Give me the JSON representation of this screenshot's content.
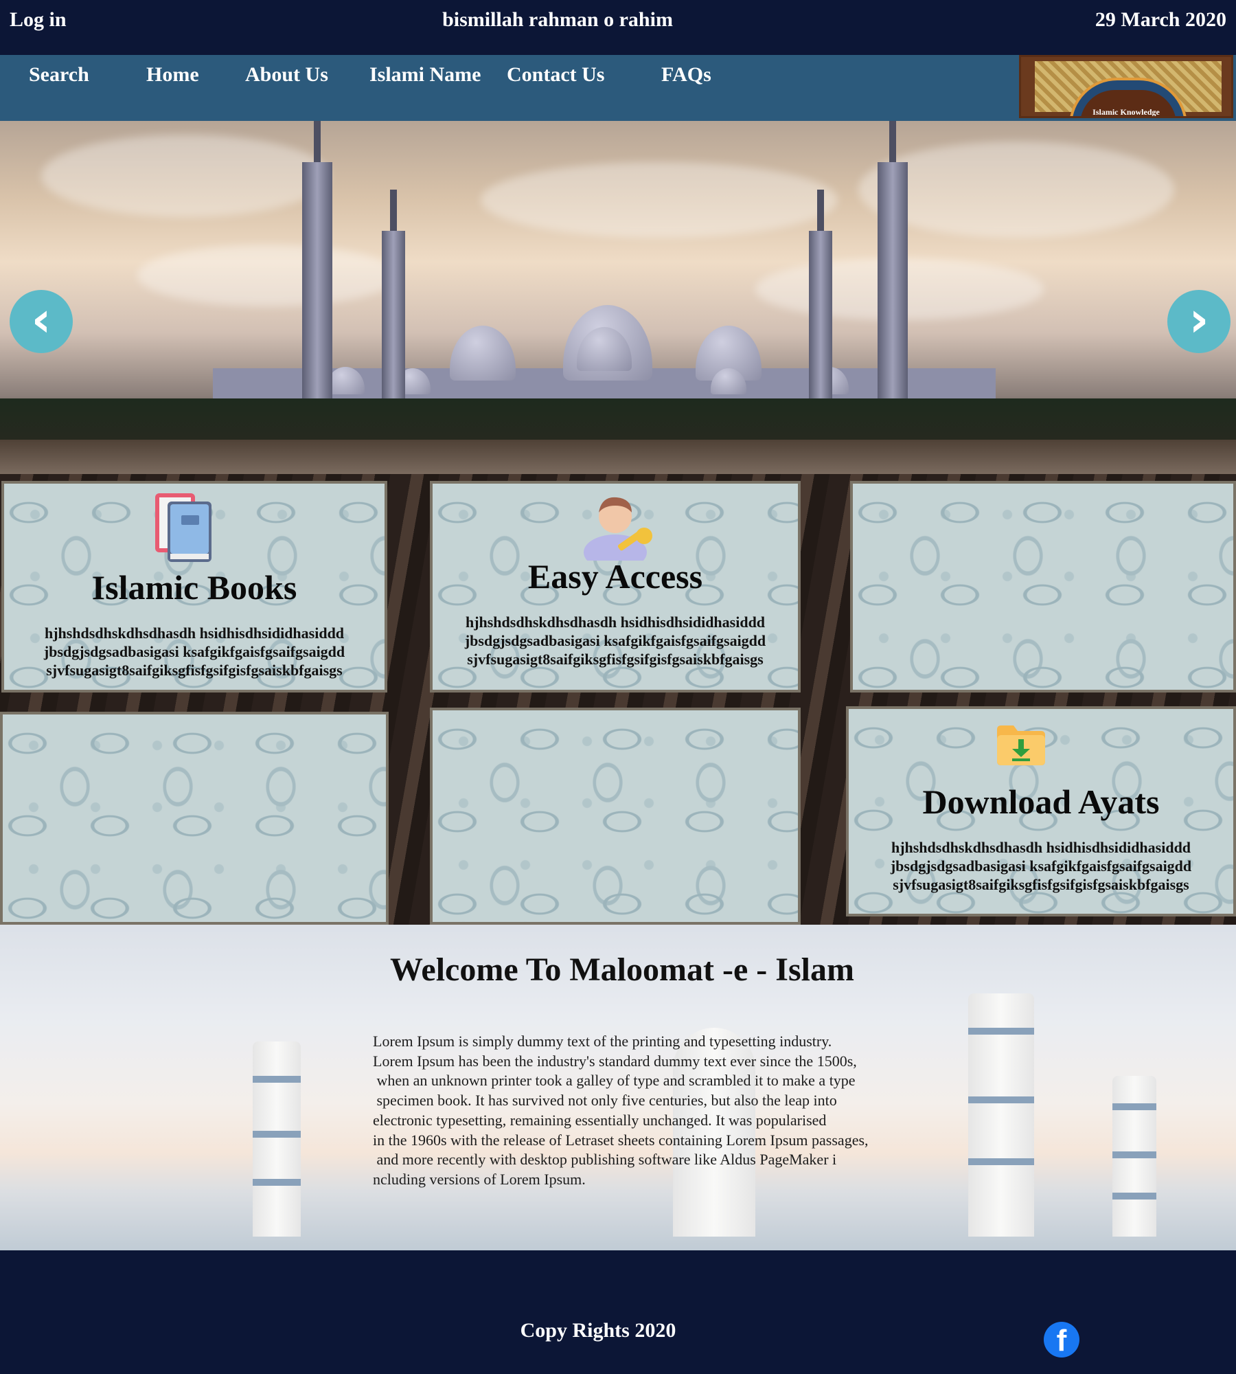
{
  "topbar": {
    "login_label": "Log in",
    "greeting": "bismillah rahman o rahim",
    "date": "29 March 2020"
  },
  "nav": {
    "items": [
      {
        "label": "Search"
      },
      {
        "label": "Home"
      },
      {
        "label": "About Us"
      },
      {
        "label": "Islami Name"
      },
      {
        "label": "Contact Us"
      },
      {
        "label": "FAQs"
      }
    ],
    "logo_text": "Islamic Knowledge"
  },
  "carousel": {
    "prev_icon": "chevron-left-icon",
    "next_icon": "chevron-right-icon",
    "accent_color": "#5cbac8"
  },
  "features": [
    {
      "title": "Islamic Books",
      "icon": "books-icon",
      "text": "hjhshdsdhskdhsdhasdh hsidhisdhsididhasiddd\njbsdgjsdgsadbasigasi ksafgikfgaisfgsaifgsaigdd\nsjvfsugasigt8saifgiksgfisfgsifgisfgsaiskbfgaisgs"
    },
    {
      "title": "Easy Access",
      "icon": "user-key-icon",
      "text": "hjhshdsdhskdhsdhasdh hsidhisdhsididhasiddd\njbsdgjsdgsadbasigasi ksafgikfgaisfgsaifgsaigdd\nsjvfsugasigt8saifgiksgfisfgsifgisfgsaiskbfgaisgs"
    },
    {
      "title": "Download Ayats",
      "icon": "download-folder-icon",
      "text": "hjhshdsdhskdhsdhasdh hsidhisdhsididhasiddd\njbsdgjsdgsadbasigasi ksafgikfgaisfgsaifgsaigdd\nsjvfsugasigt8saifgiksgfisfgsifgisfgsaiskbfgaisgs"
    }
  ],
  "welcome": {
    "title": "Welcome To Maloomat -e - Islam",
    "body": "Lorem Ipsum is simply dummy text of the printing and typesetting industry.\nLorem Ipsum has been the industry's standard dummy text ever since the 1500s,\n when an unknown printer took a galley of type and scrambled it to make a type\n specimen book. It has survived not only five centuries, but also the leap into\nelectronic typesetting, remaining essentially unchanged. It was popularised\nin the 1960s with the release of Letraset sheets containing Lorem Ipsum passages,\n and more recently with desktop publishing software like Aldus PageMaker i\nncluding versions of Lorem Ipsum."
  },
  "footer": {
    "copyright": "Copy Rights 2020",
    "social_icon": "facebook-icon",
    "social_color": "#1877f2"
  },
  "colors": {
    "topbar_bg": "#0c1636",
    "nav_bg": "#2c5a7c"
  }
}
